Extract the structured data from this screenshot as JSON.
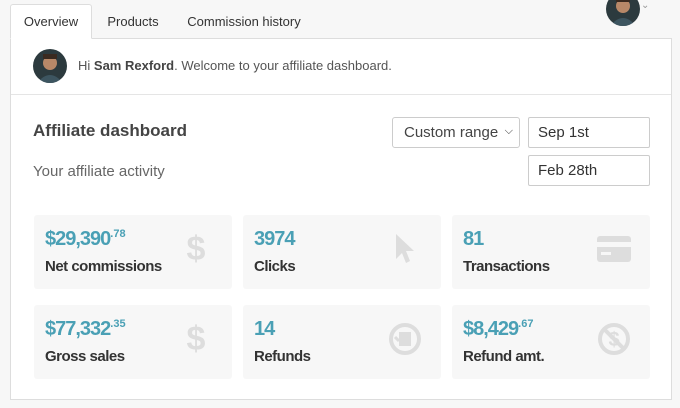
{
  "tabs": [
    {
      "label": "Overview",
      "active": true
    },
    {
      "label": "Products",
      "active": false
    },
    {
      "label": "Commission history",
      "active": false
    }
  ],
  "welcome": {
    "greeting": "Hi",
    "name": "Sam Rexford",
    "message": ". Welcome to your affiliate dashboard."
  },
  "dashboard": {
    "title": "Affiliate dashboard",
    "subtitle": "Your affiliate activity",
    "range_select": "Custom range",
    "date_from": "Sep 1st",
    "date_to": "Feb 28th"
  },
  "stats": [
    {
      "value": "$29,390",
      "cents": ".78",
      "label": "Net commissions",
      "icon": "dollar-icon"
    },
    {
      "value": "3974",
      "cents": "",
      "label": "Clicks",
      "icon": "cursor-icon"
    },
    {
      "value": "81",
      "cents": "",
      "label": "Transactions",
      "icon": "credit-card-icon"
    },
    {
      "value": "$77,332",
      "cents": ".35",
      "label": "Gross sales",
      "icon": "dollar-icon"
    },
    {
      "value": "14",
      "cents": "",
      "label": "Refunds",
      "icon": "refund-icon"
    },
    {
      "value": "$8,429",
      "cents": ".67",
      "label": "Refund amt.",
      "icon": "no-dollar-icon"
    }
  ],
  "colors": {
    "accent": "#4aa0b5",
    "icon": "#dddddd",
    "card_bg": "#f7f7f7"
  }
}
